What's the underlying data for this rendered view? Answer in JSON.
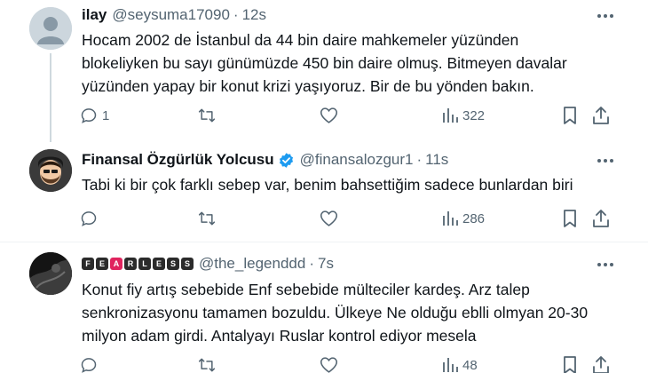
{
  "tweets": [
    {
      "name": "ilay",
      "handle": "@seysuma17090",
      "time": "12s",
      "lines": [
        "Hocam 2002 de İstanbul da 44 bin daire mahkemeler yüzünden",
        "blokeliyken bu sayı günümüzde 450 bin daire olmuş. Bitmeyen davalar",
        "yüzünden yapay bir konut krizi yaşıyoruz. Bir de bu yönden bakın."
      ],
      "replies": "1",
      "views": "322"
    },
    {
      "name": "Finansal Özgürlük Yolcusu",
      "handle": "@finansalozgur1",
      "time": "11s",
      "lines": [
        "Tabi ki bir çok farklı sebep var, benim bahsettiğim sadece bunlardan biri"
      ],
      "replies": "",
      "views": "286"
    },
    {
      "name_badges": [
        "F",
        "E",
        "A",
        "R",
        "L",
        "E",
        "S",
        "S"
      ],
      "handle": "@the_legenddd",
      "time": "7s",
      "lines": [
        "Konut fiy artış sebebide Enf sebebide mülteciler kardeş. Arz talep",
        "senkronizasyonu tamamen bozuldu. Ülkeye Ne olduğu eblli olmyan 20-30",
        "milyon adam girdi. Antalyayı Ruslar kontrol ediyor mesela"
      ],
      "replies": "",
      "views": "48"
    }
  ],
  "separator_dot": "·",
  "colors": {
    "secondary": "#536471",
    "verified": "#1d9bf0",
    "fearless_accent": "#e0245e"
  }
}
